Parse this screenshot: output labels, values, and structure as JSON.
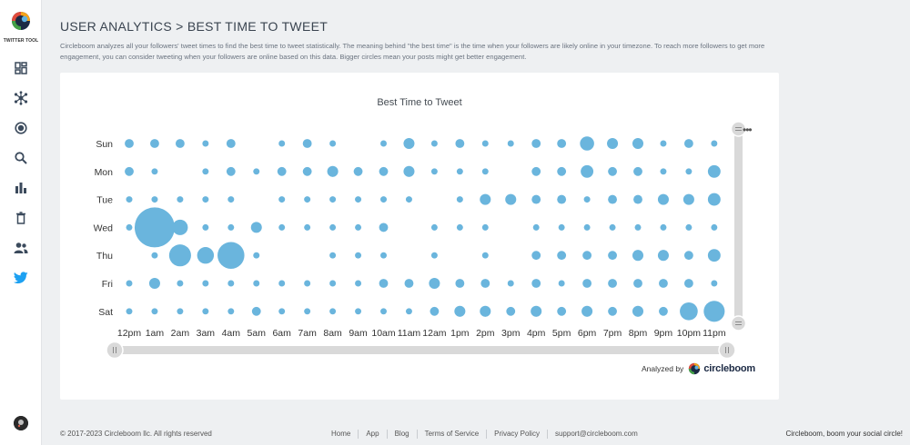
{
  "sidebar": {
    "logo_text": "TWITTER TOOL",
    "items": [
      {
        "icon": "dashboard-icon"
      },
      {
        "icon": "network-icon"
      },
      {
        "icon": "record-icon"
      },
      {
        "icon": "search-icon"
      },
      {
        "icon": "bar-chart-icon"
      },
      {
        "icon": "trash-icon"
      },
      {
        "icon": "users-icon"
      },
      {
        "icon": "twitter-icon"
      }
    ]
  },
  "header": {
    "title": "USER ANALYTICS > BEST TIME TO TWEET",
    "description": "Circleboom analyzes all your followers' tweet times to find the best time to tweet statistically. The meaning behind \"the best time\" is the time when your followers are likely online in your timezone. To reach more followers to get more engagement, you can consider tweeting when your followers are online based on this data. Bigger circles mean your posts might get better engagement."
  },
  "chart_data": {
    "type": "scatter",
    "title": "Best Time to Tweet",
    "x": [
      "12pm",
      "1am",
      "2am",
      "3am",
      "4am",
      "5am",
      "6am",
      "7am",
      "8am",
      "9am",
      "10am",
      "11am",
      "12am",
      "1pm",
      "2pm",
      "3pm",
      "4pm",
      "5pm",
      "6pm",
      "7pm",
      "8pm",
      "9pm",
      "10pm",
      "11pm"
    ],
    "y": [
      "Sun",
      "Mon",
      "Tue",
      "Wed",
      "Thu",
      "Fri",
      "Sat"
    ],
    "values": [
      [
        2,
        2,
        2,
        1,
        2,
        0,
        1,
        2,
        1,
        0,
        1,
        3,
        1,
        2,
        1,
        1,
        2,
        2,
        5,
        3,
        3,
        1,
        2,
        1
      ],
      [
        2,
        1,
        0,
        1,
        2,
        1,
        2,
        2,
        3,
        2,
        2,
        3,
        1,
        1,
        1,
        0,
        2,
        2,
        4,
        2,
        2,
        1,
        1,
        4
      ],
      [
        1,
        1,
        1,
        1,
        1,
        0,
        1,
        1,
        1,
        1,
        1,
        1,
        0,
        1,
        3,
        3,
        2,
        2,
        1,
        2,
        2,
        3,
        3,
        4
      ],
      [
        1,
        40,
        6,
        1,
        1,
        3,
        1,
        1,
        1,
        1,
        2,
        0,
        1,
        1,
        1,
        0,
        1,
        1,
        1,
        1,
        1,
        1,
        1,
        1
      ],
      [
        0,
        1,
        12,
        7,
        18,
        1,
        0,
        0,
        1,
        1,
        1,
        0,
        1,
        0,
        1,
        0,
        2,
        2,
        2,
        2,
        3,
        3,
        2,
        4
      ],
      [
        1,
        3,
        1,
        1,
        1,
        1,
        1,
        1,
        1,
        1,
        2,
        2,
        3,
        2,
        2,
        1,
        2,
        1,
        2,
        2,
        2,
        2,
        2,
        1
      ],
      [
        1,
        1,
        1,
        1,
        1,
        2,
        1,
        1,
        1,
        1,
        1,
        1,
        2,
        3,
        3,
        2,
        3,
        2,
        3,
        2,
        3,
        2,
        8,
        11
      ]
    ],
    "color": "#6ab5dd",
    "grid": false,
    "legend": "none"
  },
  "analyzed": {
    "prefix": "Analyzed by",
    "brand": "circleboom"
  },
  "footer": {
    "copyright": "© 2017-2023 Circleboom llc. All rights reserved",
    "links": [
      "Home",
      "App",
      "Blog",
      "Terms of Service",
      "Privacy Policy",
      "support@circleboom.com"
    ],
    "tagline": "Circleboom, boom your social circle!"
  }
}
